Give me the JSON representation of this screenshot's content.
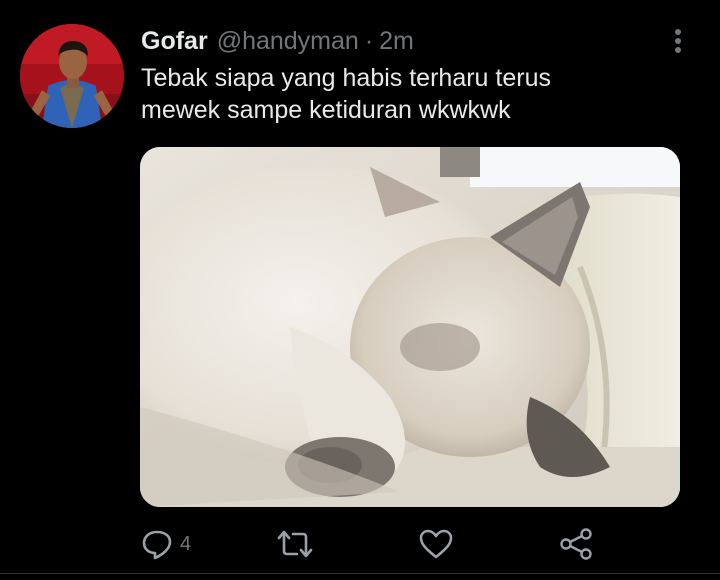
{
  "tweet": {
    "display_name": "Gofar",
    "handle": "@handyman",
    "separator": "·",
    "time": "2m",
    "text": "Tebak siapa yang habis terharu terus\nmewek sampe ketiduran wkwkwk",
    "media_icon": "photo-sleeping-kitten",
    "avatar_icon": "profile-photo-person"
  },
  "actions": {
    "reply": {
      "icon": "reply-icon",
      "count": "4"
    },
    "retweet": {
      "icon": "retweet-icon"
    },
    "like": {
      "icon": "heart-icon"
    },
    "share": {
      "icon": "share-icon"
    }
  },
  "colors": {
    "background": "#000000",
    "primary_text": "#e7e9ea",
    "secondary_text": "#71767b",
    "divider": "#2f3336"
  }
}
